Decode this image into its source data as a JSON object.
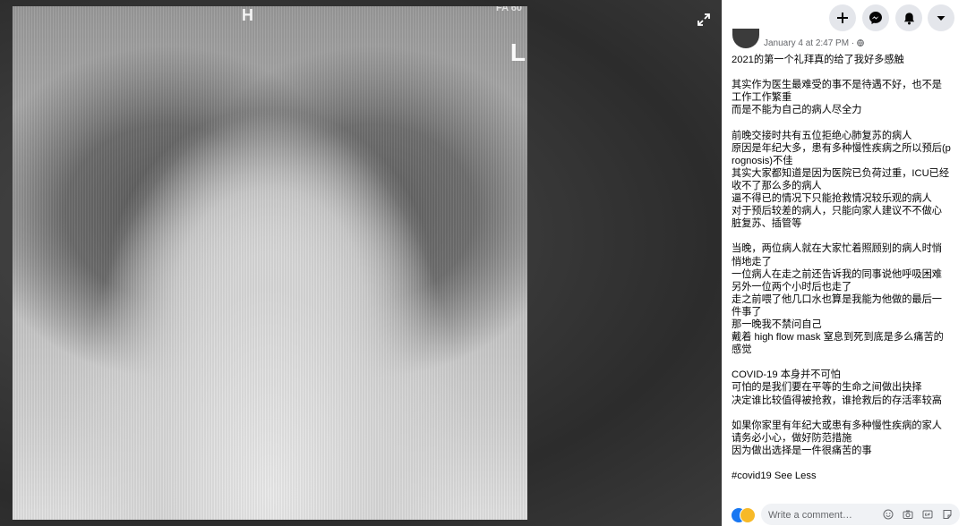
{
  "viewer": {
    "image_markers": {
      "h_marker": "H",
      "corner_code": "FA 60",
      "side_marker": "L"
    },
    "expand_icon": "expand-arrows-icon"
  },
  "header": {
    "buttons": [
      {
        "name": "create",
        "icon": "plus-icon"
      },
      {
        "name": "messenger",
        "icon": "messenger-icon"
      },
      {
        "name": "notifications",
        "icon": "bell-icon"
      },
      {
        "name": "account",
        "icon": "caret-down-icon"
      }
    ],
    "button_bg": "#e4e6eb"
  },
  "post": {
    "timestamp": "January 4 at 2:47 PM · ",
    "privacy_icon": "globe-icon",
    "body": "2021的第一个礼拜真的给了我好多感触\n\n其实作为医生最难受的事不是待遇不好，也不是工作工作繁重\n而是不能为自己的病人尽全力\n\n前晚交接时共有五位拒绝心肺复苏的病人\n原因是年纪大多，患有多种慢性疾病之所以预后(prognosis)不佳\n其实大家都知道是因为医院已负荷过重，ICU已经收不了那么多的病人\n逼不得已的情况下只能抢救情况较乐观的病人\n对于预后较差的病人，只能向家人建议不不做心脏复苏、插管等\n\n当晚，两位病人就在大家忙着照顾别的病人时悄悄地走了\n一位病人在走之前还告诉我的同事说他呼吸困难\n另外一位两个小时后也走了\n走之前喂了他几口水也算是我能为他做的最后一件事了\n那一晚我不禁问自己\n戴着 high flow mask 窒息到死到底是多么痛苦的感觉\n\nCOVID-19 本身并不可怕\n可怕的是我们要在平等的生命之间做出抉择\n决定谁比较值得被抢救，谁抢救后的存活率较高\n\n如果你家里有年纪大或患有多种慢性疾病的家人请务必小心，做好防范措施\n因为做出选择是一件很痛苦的事\n\n#covid19 ",
    "see_less": "See Less"
  },
  "comment": {
    "placeholder": "Write a comment…",
    "icons": [
      "emoji-icon",
      "camera-icon",
      "gif-icon",
      "sticker-icon"
    ]
  },
  "colors": {
    "text": "#050505",
    "secondary": "#65676b",
    "like_blue": "#1877f2",
    "haha_yellow": "#f7b928"
  }
}
